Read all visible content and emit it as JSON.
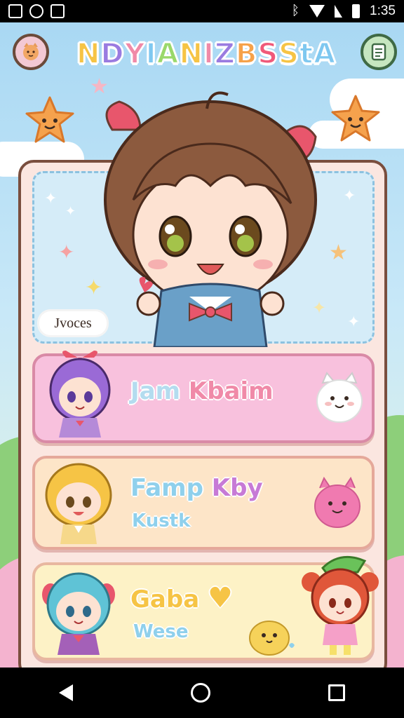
{
  "status_bar": {
    "time": "1:35"
  },
  "header": {
    "title_letters": [
      {
        "ch": "N",
        "color": "#f6c445"
      },
      {
        "ch": "D",
        "color": "#9a7be0"
      },
      {
        "ch": "Y",
        "color": "#f08aa8"
      },
      {
        "ch": "I",
        "color": "#7fc8f0"
      },
      {
        "ch": "A",
        "color": "#9ad86a"
      },
      {
        "ch": "N",
        "color": "#f6c445"
      },
      {
        "ch": "I",
        "color": "#f08aa8"
      },
      {
        "ch": "Z",
        "color": "#9a7be0"
      },
      {
        "ch": "B",
        "color": "#f6a24a"
      },
      {
        "ch": "S",
        "color": "#f05a7a"
      },
      {
        "ch": "S",
        "color": "#f6c445"
      },
      {
        "ch": "t",
        "color": "#7fc8f0"
      },
      {
        "ch": "A",
        "color": "#7fc8f0"
      }
    ],
    "left_button_icon": "cat-face-icon",
    "right_button_icon": "menu-list-icon"
  },
  "hero": {
    "tag": "Jvoces"
  },
  "cards": [
    {
      "name": "Jam Kbaim",
      "sub": "",
      "name_colors": [
        "#b4dcef",
        "#f08aa8"
      ],
      "companion_icon": "white-cat-plush-icon"
    },
    {
      "name": "Famp Kby",
      "sub": "Kustk",
      "name_colors": [
        "#8fd0ec",
        "#c77ad6"
      ],
      "companion_icon": "pink-blob-icon"
    },
    {
      "name": "Gaba",
      "sub": "Wese",
      "name_colors": [
        "#f6c445",
        "#f6c445"
      ],
      "companion_icon": "yellow-chick-icon"
    }
  ],
  "colors": {
    "panel_border": "#7a4e3e",
    "accent_pink": "#f8c1dd",
    "accent_peach": "#fde5c8",
    "accent_cream": "#fdf2c6"
  }
}
